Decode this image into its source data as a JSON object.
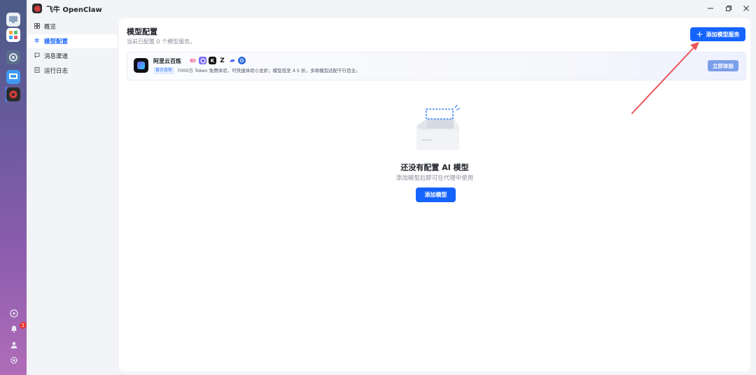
{
  "window": {
    "title": "飞牛 OpenClaw"
  },
  "nav": {
    "items": [
      {
        "label": "概览",
        "icon": "grid-icon"
      },
      {
        "label": "模型配置",
        "icon": "sparkle-icon"
      },
      {
        "label": "消息渠道",
        "icon": "chat-icon"
      },
      {
        "label": "运行日志",
        "icon": "log-icon"
      }
    ],
    "active_index": 1
  },
  "page": {
    "title": "模型配置",
    "subtitle": "当前已配置 0 个模型服务。",
    "add_service_label": "添加模型服务"
  },
  "banner": {
    "name": "阿里云百炼",
    "tag": "官方合作",
    "description": "7000万 Token 免费体验，可快速体验小龙虾；模型低至 4.5 折，多款模型适配千行百业。",
    "cta_label": "立即体验"
  },
  "empty_state": {
    "title": "还没有配置 AI 模型",
    "subtitle": "添加模型后即可在代理中使用",
    "button_label": "添加模型"
  },
  "notifications": {
    "badge_count": "1"
  },
  "colors": {
    "accent": "#1664ff",
    "annotation_arrow": "#e8545a"
  }
}
